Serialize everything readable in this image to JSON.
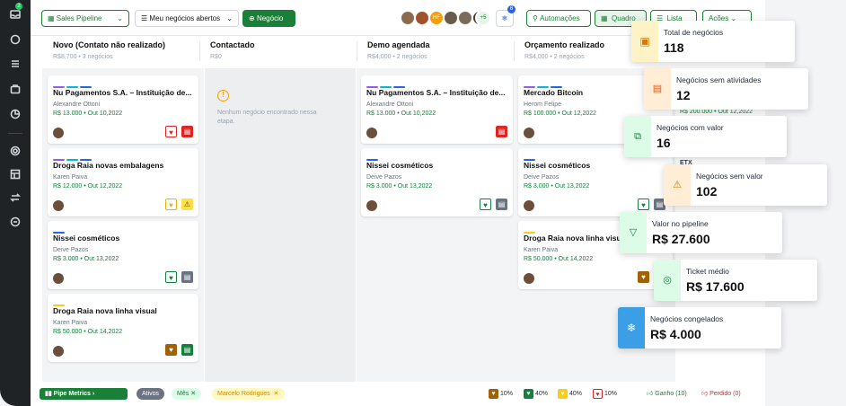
{
  "sidebar": {
    "badge": "2"
  },
  "toolbar": {
    "pipeline": "Sales Pipeline",
    "filter": "Meu negócios abertos",
    "new_deal": "Negócio",
    "avatars_initials": "HF",
    "avatars_more": "+5",
    "freeze_badge": "6",
    "automations": "Automações",
    "view_board": "Quadro",
    "view_list": "Lista",
    "actions": "Ações"
  },
  "columns": [
    {
      "title": "Novo (Contato não realizado)",
      "summary": "R$8,700 • 3 negócios"
    },
    {
      "title": "Contactado",
      "summary": "R$0",
      "empty": "Nenhum negócio encontrado nessa etapa."
    },
    {
      "title": "Demo agendada",
      "summary": "R$4,000 • 2 negócios"
    },
    {
      "title": "Orçamento realizado",
      "summary": "R$4,000 • 2 negócios"
    }
  ],
  "cards": {
    "c1": {
      "title": "Nu Pagamentos S.A. – Instituição de...",
      "person": "Alexandre Ottoni",
      "value": "R$ 13.000  •  Out 10,2022"
    },
    "c2": {
      "title": "Droga Raia novas embalagens",
      "person": "Karen Paiva",
      "value": "R$ 12.000  •  Out 12,2022"
    },
    "c3": {
      "title": "Nissei cosméticos",
      "person": "Deive Pazos",
      "value": "R$ 3.000  •  Out 13,2022"
    },
    "c4": {
      "title": "Droga Raia nova linha visual",
      "person": "Karen Paiva",
      "value": "R$ 50.000  •  Out 14,2022"
    },
    "d1": {
      "title": "Nu Pagamentos S.A. – Instituição de...",
      "person": "Alexandre Ottoni",
      "value": "R$ 13.000  •  Out 10,2022"
    },
    "d2": {
      "title": "Nissei cosméticos",
      "person": "Deive Pazos",
      "value": "R$ 3.000  •  Out 13,2022"
    },
    "o1": {
      "title": "Mercado Bitcoin",
      "person": "Herom Felipe",
      "value": "R$ 100.000  •  Out 12,2022"
    },
    "o2": {
      "title": "Nissei cosméticos",
      "person": "Deive Pazos",
      "value": "R$ 3.000  •  Out 13,2022"
    },
    "o3": {
      "title": "Droga Raia nova linha visual",
      "person": "Karen Paiva",
      "value": "R$ 50.000  •  Out 14,2022"
    }
  },
  "partial": {
    "v1": "R$ 200.000  •  Out 12,2022",
    "t1": "ETX"
  },
  "metrics": [
    {
      "label": "Total de negócios",
      "value": "118"
    },
    {
      "label": "Negócios sem atividades",
      "value": "12"
    },
    {
      "label": "Negócios com valor",
      "value": "16"
    },
    {
      "label": "Negócios sem valor",
      "value": "102"
    },
    {
      "label": "Valor no pipeline",
      "value": "R$ 27.600"
    },
    {
      "label": "Ticket médio",
      "value": "R$ 17.600"
    },
    {
      "label": "Negócios congelados",
      "value": "R$ 4.000"
    }
  ],
  "bottom": {
    "pipe_metrics": "Pipe Metrics",
    "status": "Ativos",
    "period": "Mês",
    "owner": "Marcelo Rodrigues",
    "p1": "10%",
    "p2": "40%",
    "p3": "40%",
    "p4": "10%",
    "won": "Ganho (10)",
    "lost": "Perdido (0)"
  },
  "colors": {
    "accent": "#1a7f37",
    "purple": "#8b5cf6",
    "blue": "#2563eb",
    "cyan": "#06b6d4",
    "yellow": "#facc15"
  }
}
